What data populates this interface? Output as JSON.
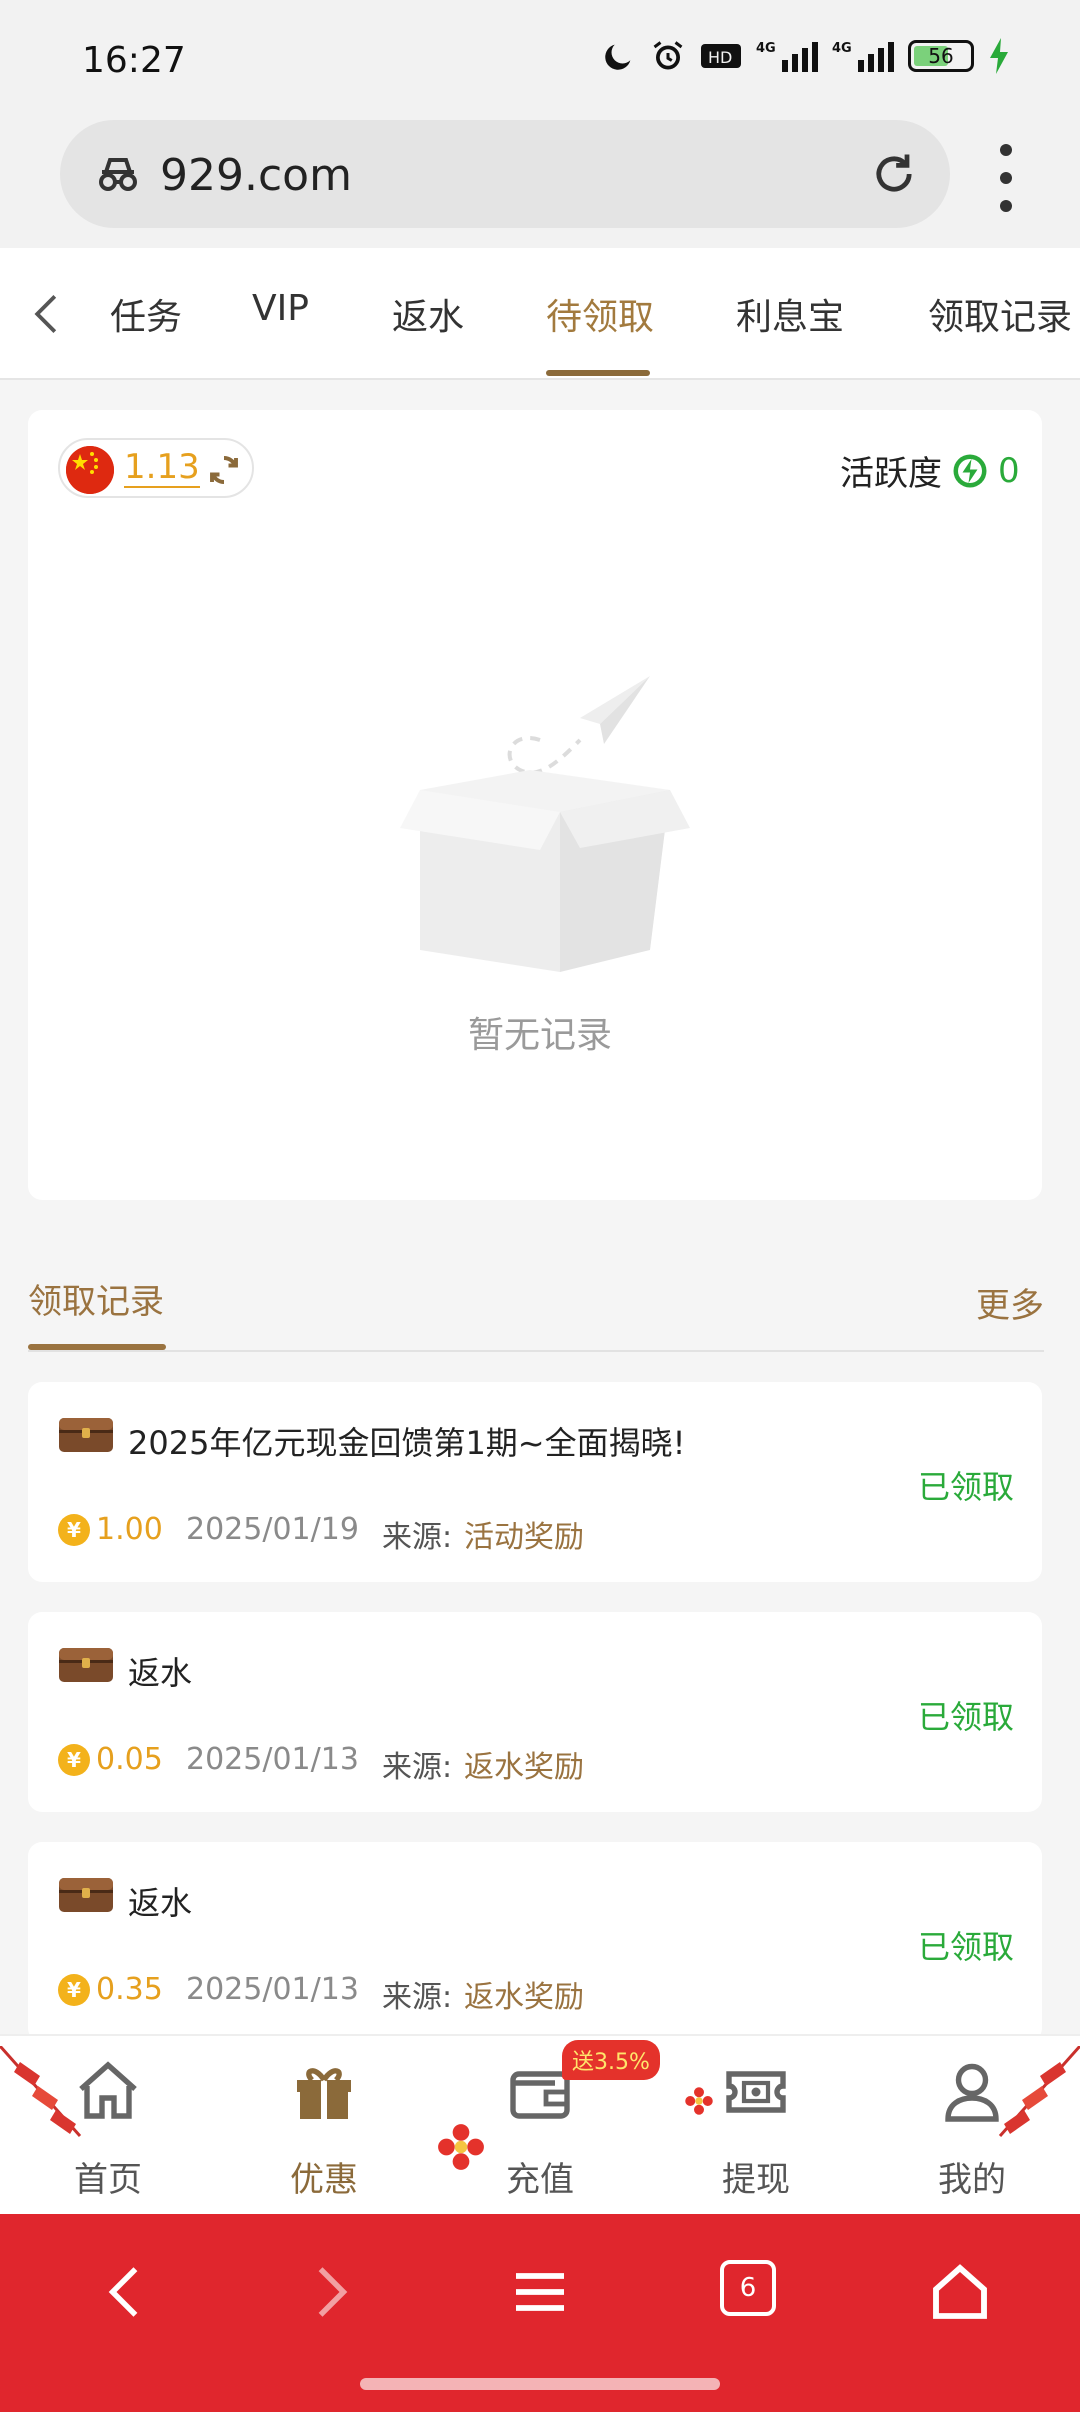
{
  "status_bar": {
    "time": "16:27",
    "battery": "56",
    "net1": "4G",
    "net2": "4G",
    "hd": "HD"
  },
  "url_bar": {
    "url": "929.com"
  },
  "tabs": [
    {
      "label": "任务",
      "active": false
    },
    {
      "label": "VIP",
      "active": false
    },
    {
      "label": "返水",
      "active": false
    },
    {
      "label": "待领取",
      "active": true
    },
    {
      "label": "利息宝",
      "active": false
    },
    {
      "label": "领取记录",
      "active": false
    }
  ],
  "summary": {
    "balance": "1.13",
    "activity_label": "活跃度",
    "activity_value": "0",
    "empty_text": "暂无记录"
  },
  "records": {
    "title": "领取记录",
    "more": "更多",
    "source_label": "来源:",
    "items": [
      {
        "name": "2025年亿元现金回馈第1期~全面揭晓!",
        "amount": "1.00",
        "date": "2025/01/19",
        "source": "活动奖励",
        "status": "已领取"
      },
      {
        "name": "返水",
        "amount": "0.05",
        "date": "2025/01/13",
        "source": "返水奖励",
        "status": "已领取"
      },
      {
        "name": "返水",
        "amount": "0.35",
        "date": "2025/01/13",
        "source": "返水奖励",
        "status": "已领取"
      }
    ]
  },
  "app_nav": {
    "items": [
      {
        "label": "首页",
        "icon": "home-icon"
      },
      {
        "label": "优惠",
        "icon": "gift-icon"
      },
      {
        "label": "充值",
        "icon": "wallet-icon"
      },
      {
        "label": "提现",
        "icon": "withdraw-icon"
      },
      {
        "label": "我的",
        "icon": "user-icon"
      }
    ],
    "badge": "送3.5%"
  },
  "browser_nav": {
    "tab_count": "6"
  },
  "colors": {
    "accent": "#8b6a3a",
    "gold": "#e6a01e",
    "green": "#2aaa3a",
    "red_bar": "#e0262d"
  }
}
